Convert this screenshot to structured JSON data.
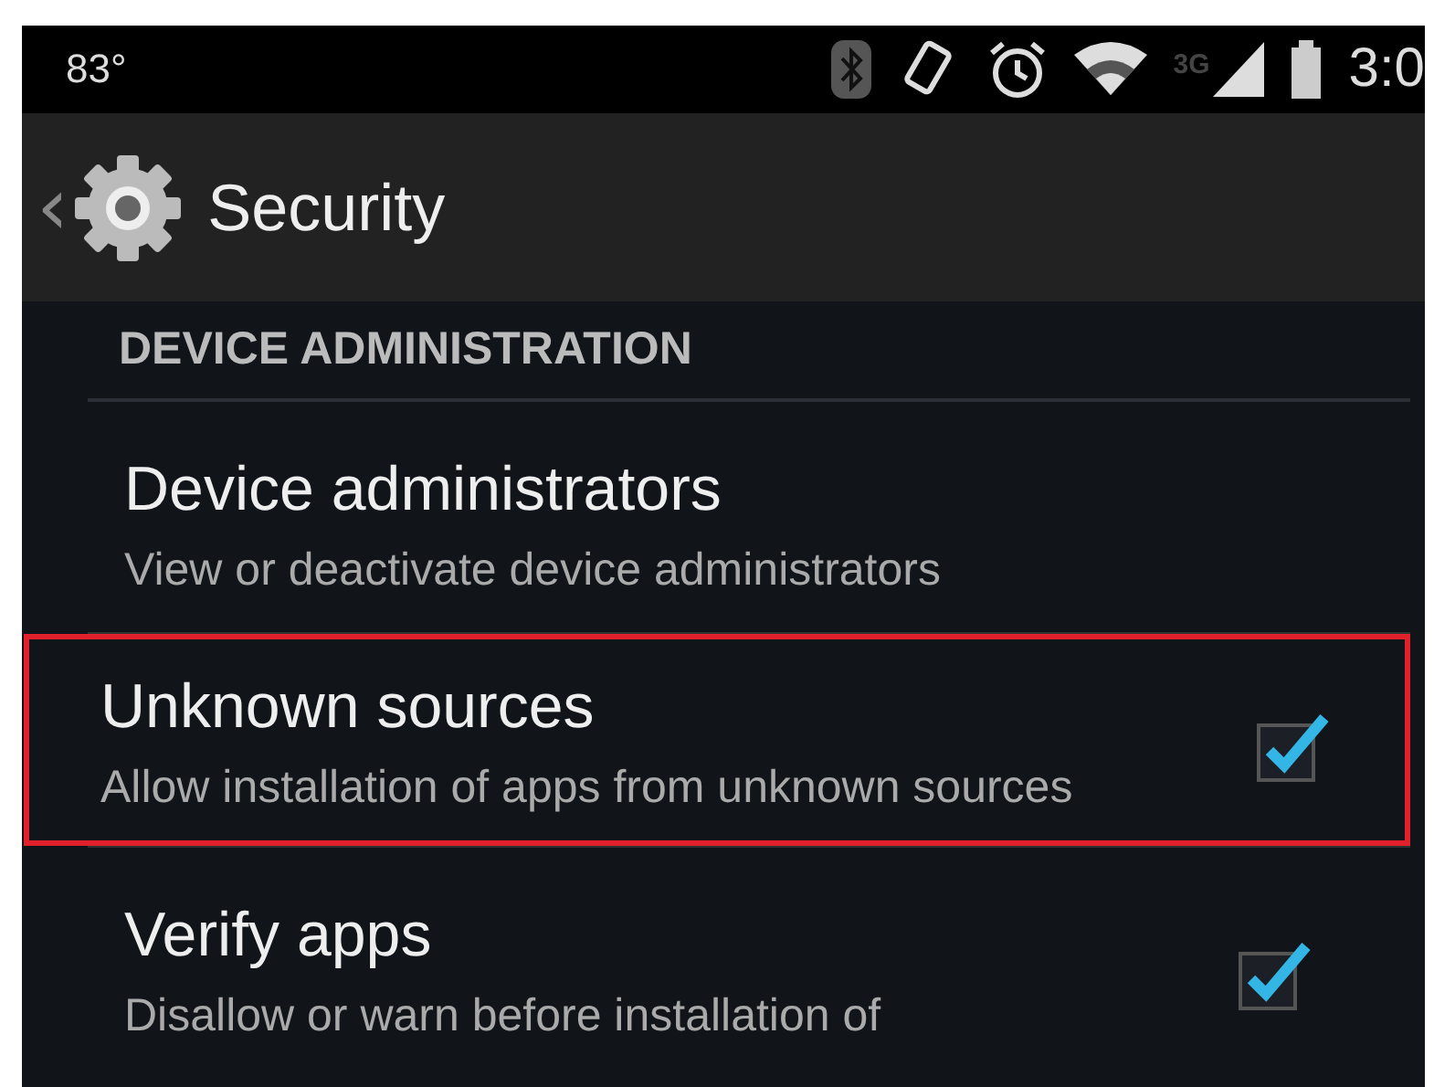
{
  "status_bar": {
    "temperature": "83°",
    "network_type": "3G",
    "time": "3:0"
  },
  "action_bar": {
    "back": "‹",
    "title": "Security"
  },
  "section": {
    "header": "DEVICE ADMINISTRATION"
  },
  "items": [
    {
      "kind": "plain",
      "title": "Device administrators",
      "summary": "View or deactivate device administrators",
      "highlighted": false
    },
    {
      "kind": "checkbox",
      "title": "Unknown sources",
      "summary": "Allow installation of apps from unknown sources",
      "checked": true,
      "highlighted": true
    },
    {
      "kind": "checkbox",
      "title": "Verify apps",
      "summary": "Disallow or warn before installation of",
      "checked": true,
      "highlighted": false
    }
  ]
}
